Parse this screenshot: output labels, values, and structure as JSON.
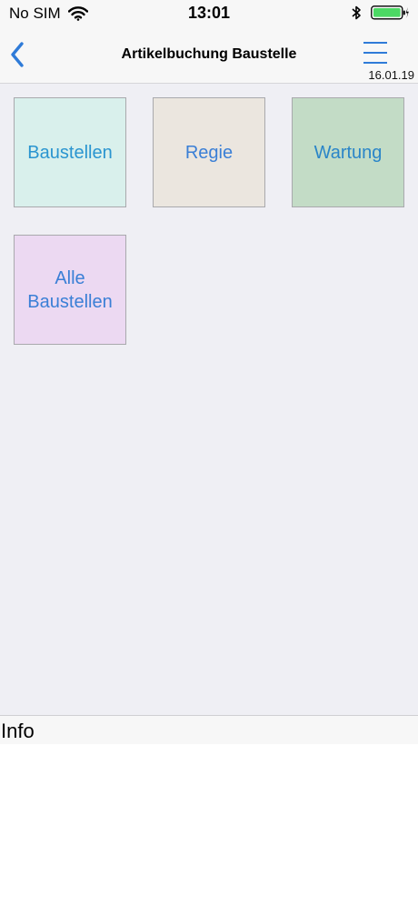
{
  "status_bar": {
    "carrier": "No SIM",
    "time": "13:01",
    "wifi_icon": "wifi-icon",
    "bluetooth_icon": "bluetooth-icon",
    "battery_icon": "battery-charging-icon"
  },
  "nav": {
    "back_icon": "chevron-left-icon",
    "title": "Artikelbuchung Baustelle",
    "menu_icon": "hamburger-menu-icon",
    "date": "16.01.19",
    "accent": "#2f7bd8"
  },
  "tiles": [
    {
      "label": "Baustellen",
      "bg": "#d9f0ec"
    },
    {
      "label": "Regie",
      "bg": "#ebe6df"
    },
    {
      "label": "Wartung",
      "bg": "#c3dcc6"
    },
    {
      "label": "Alle Baustellen",
      "bg": "#ecd9f2"
    }
  ],
  "info": {
    "label": "Info"
  }
}
